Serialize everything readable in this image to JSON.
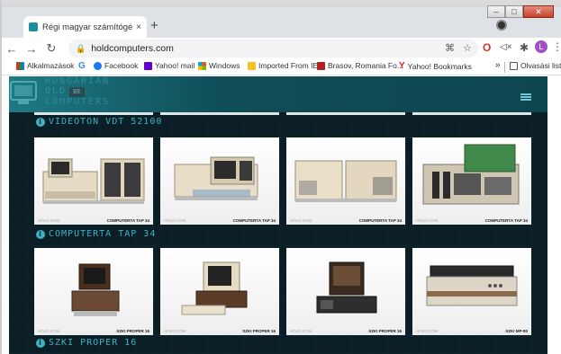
{
  "browser": {
    "tab_title": "Régi magyar számítógépek - Hu",
    "tab_close": "×",
    "new_tab": "+",
    "url": "holdcomputers.com",
    "avatar_letter": "L"
  },
  "bookmarks": [
    {
      "label": "Alkalmazások",
      "color": "#d93025"
    },
    {
      "label": "Facebook",
      "color": "#1877f2"
    },
    {
      "label": "Yahoo! mail",
      "color": "#6001d2"
    },
    {
      "label": "Windows",
      "color": "#f25022"
    },
    {
      "label": "Imported From IE",
      "color": "#f6c026"
    },
    {
      "label": "Brasov, Romania Fo...",
      "color": "#b02020"
    },
    {
      "label": "Yahoo! Bookmarks",
      "color": "#e02020"
    },
    {
      "label": "Olvasási lista",
      "color": "#555555"
    }
  ],
  "bookmarks_overflow": "»",
  "site": {
    "logo_line1": "HUNGARIAN",
    "logo_line2": "OLD",
    "logo_line3": "COMPUTERS",
    "logo_badge": "BE"
  },
  "sections": [
    {
      "title": "VIDEOTON VDT 52100"
    },
    {
      "title": "COMPUTERTA TAP 34"
    },
    {
      "title": "SZKI PROPER 16"
    }
  ],
  "cards_row1": [
    {
      "caption_left": "HOLD.COM",
      "caption_right": "COMPUTERTA TAP 34"
    },
    {
      "caption_left": "HOLD.COM",
      "caption_right": "COMPUTERTA TAP 34"
    },
    {
      "caption_left": "HOLD.COM",
      "caption_right": "COMPUTERTA TAP 34"
    },
    {
      "caption_left": "HOLD.COM",
      "caption_right": "COMPUTERTA TAP 34"
    }
  ],
  "cards_row2": [
    {
      "caption_left": "HOLD.COM",
      "caption_right": "SZKI PROPER 16"
    },
    {
      "caption_left": "HOLD.COM",
      "caption_right": "SZKI PROPER 16"
    },
    {
      "caption_left": "HOLD.COM",
      "caption_right": "SZKI PROPER 16"
    },
    {
      "caption_left": "HOLD.COM",
      "caption_right": "SZKI MP-80"
    }
  ],
  "colors": {
    "accent": "#3ab4c8",
    "page_bg": "#0b1e26",
    "header": "#1e7a85"
  }
}
